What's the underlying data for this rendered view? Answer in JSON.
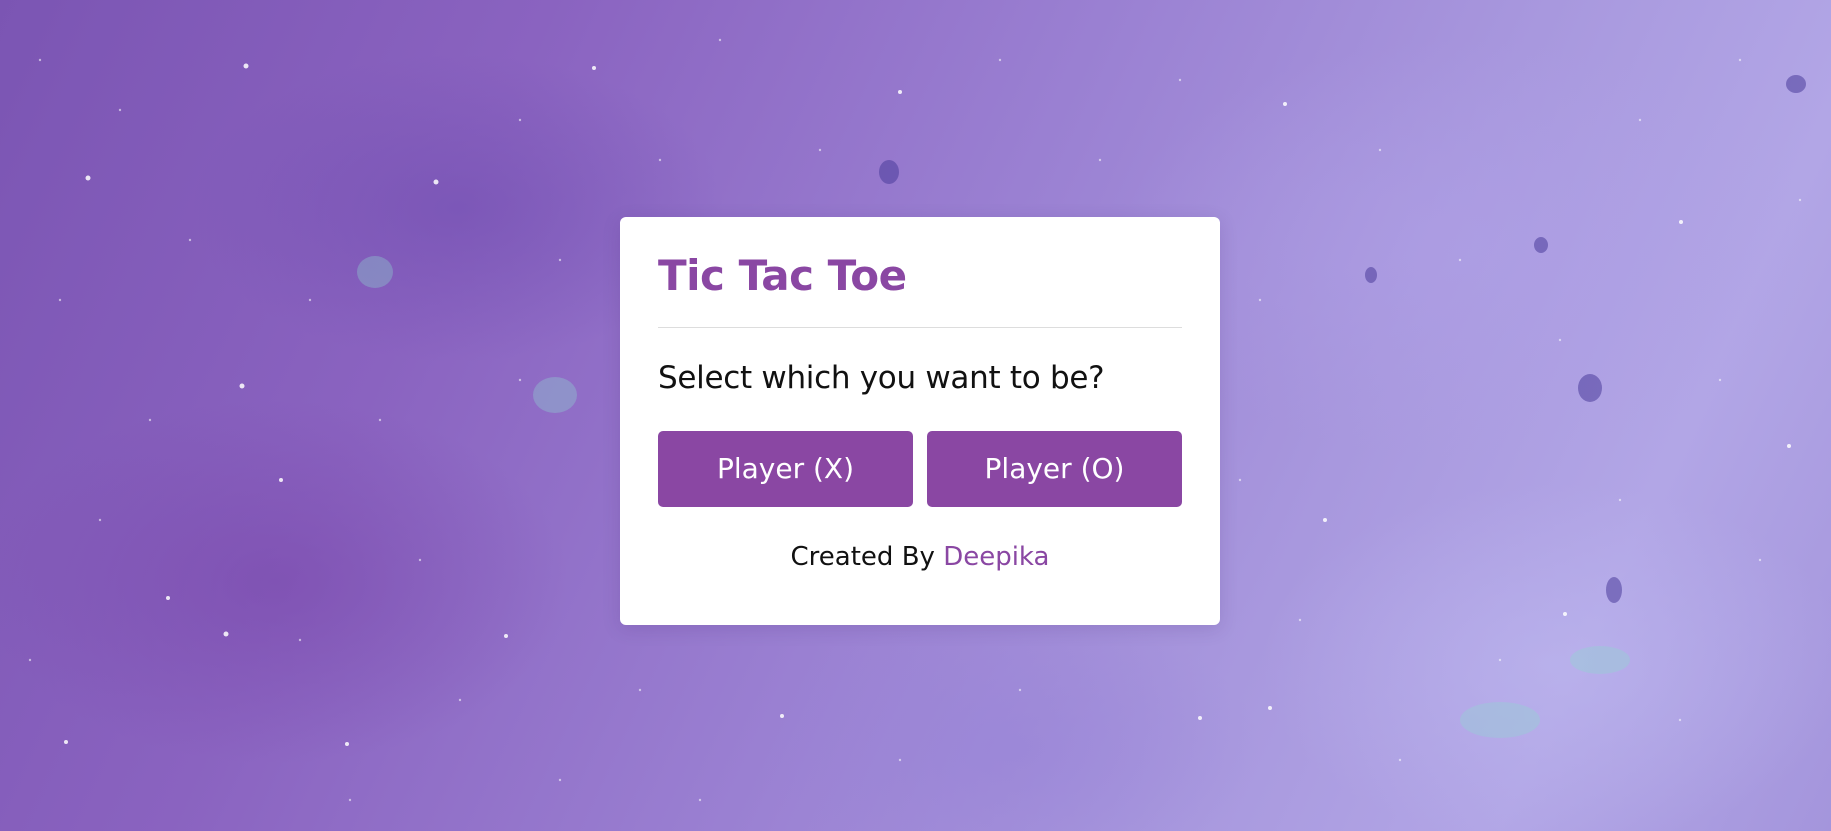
{
  "modal": {
    "title": "Tic Tac Toe",
    "prompt": "Select which you want to be?",
    "buttons": {
      "player_x": "Player (X)",
      "player_o": "Player (O)"
    },
    "credit": {
      "prefix": "Created By",
      "author": "Deepika"
    }
  },
  "colors": {
    "accent": "#8a47a3",
    "card": "#ffffff",
    "text": "#111111"
  }
}
